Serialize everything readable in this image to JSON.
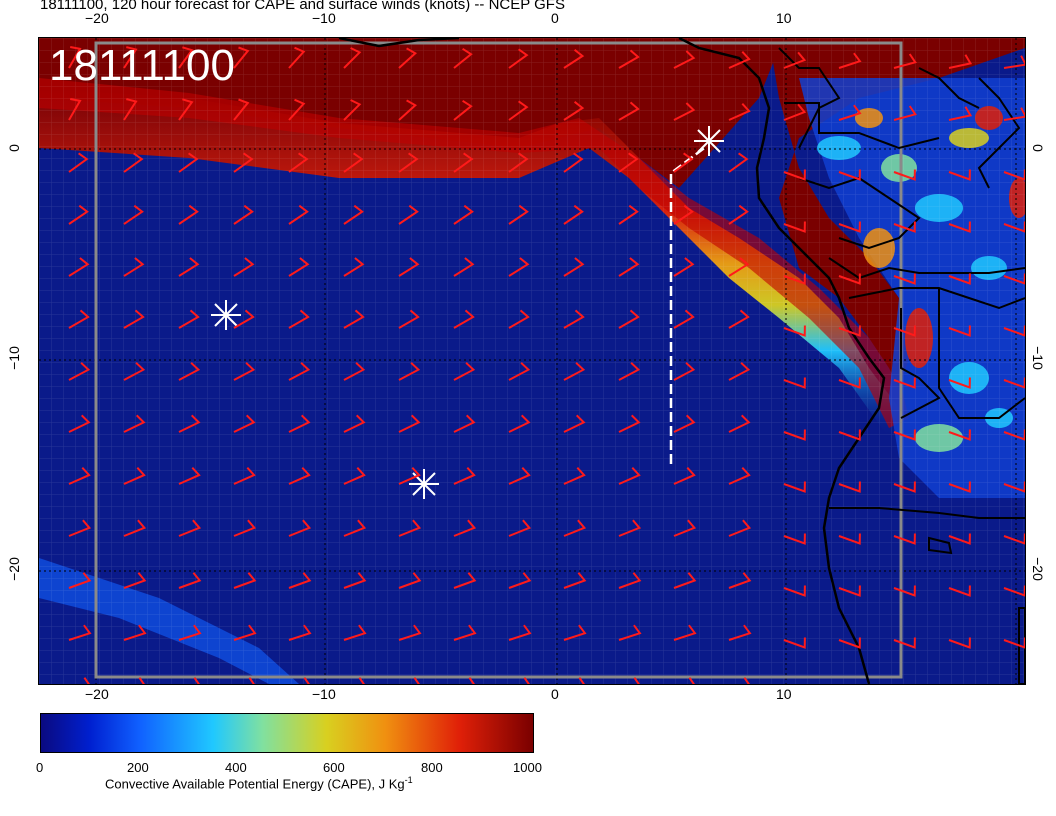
{
  "header": {
    "title": "18111100, 120 hour forecast for CAPE and surface winds (knots) -- NCEP GFS"
  },
  "map": {
    "date_label": "18111100",
    "top_ticks": [
      "−20",
      "−10",
      "0",
      "10"
    ],
    "bottom_ticks": [
      "−20",
      "−10",
      "0",
      "10"
    ],
    "left_ticks": [
      "0",
      "−10",
      "−20"
    ],
    "right_ticks": [
      "0",
      "−10",
      "−20"
    ],
    "colors": {
      "ocean_low": "#0a1a8a",
      "land_high": "#7a0000",
      "barb": "#ff1a1a",
      "marker": "#ffffff",
      "coast": "#000000"
    }
  },
  "colorbar": {
    "ticks": [
      "0",
      "200",
      "400",
      "600",
      "800",
      "1000"
    ],
    "title": "Convective Available Potential Energy (CAPE), J Kg",
    "title_sup": "-1"
  }
}
